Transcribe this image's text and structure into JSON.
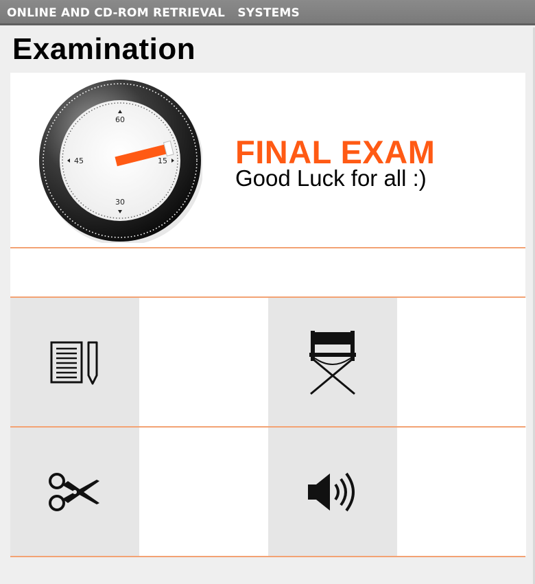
{
  "window": {
    "title": "ONLINE AND CD-ROM RETRIEVAL   SYSTEMS"
  },
  "page": {
    "heading": "Examination"
  },
  "exam": {
    "title": "FINAL EXAM",
    "subtitle": "Good Luck for all :)"
  },
  "timer": {
    "labels": {
      "top": "60",
      "right": "15",
      "bottom": "30",
      "left": "45"
    },
    "hand_minute": 15
  },
  "tiles": [
    {
      "icon": "notes-pencil-icon"
    },
    {
      "icon": "director-chair-icon"
    },
    {
      "icon": "scissors-icon"
    },
    {
      "icon": "speaker-icon"
    }
  ],
  "colors": {
    "accent": "#ff5a14",
    "divider": "#f3a273",
    "tile_gray": "#e6e6e6"
  }
}
